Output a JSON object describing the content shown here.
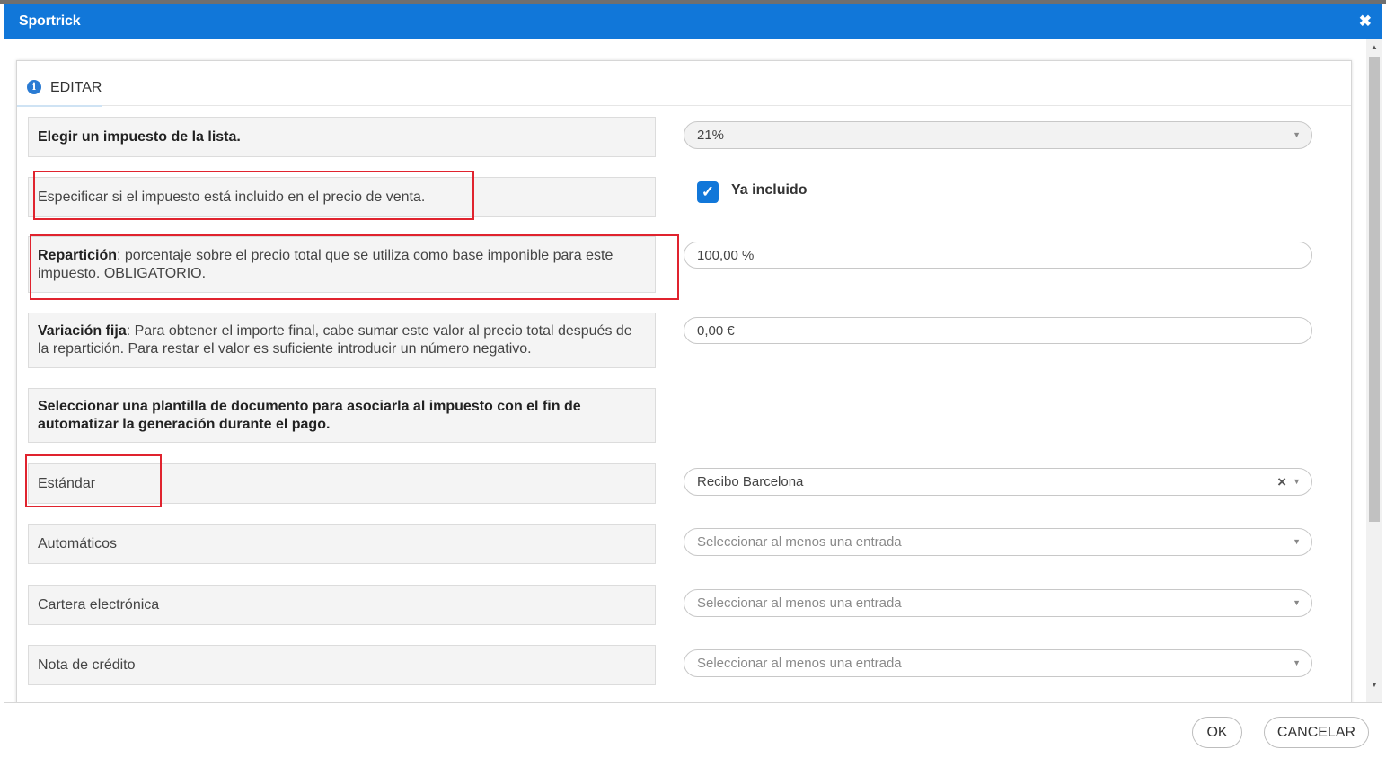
{
  "window": {
    "title": "Sportrick",
    "close_glyph": "✖"
  },
  "tab": {
    "icon": "info-icon",
    "label": "EDITAR"
  },
  "rows": {
    "tax": {
      "label": "Elegir un impuesto de la lista.",
      "value": "21%"
    },
    "included": {
      "label": "Especificar si el impuesto está incluido en el precio de venta.",
      "checkbox_label": "Ya incluido",
      "checked": true
    },
    "split": {
      "label_bold": "Repartición",
      "label_rest": ": porcentaje sobre el precio total que se utiliza como base imponible para este impuesto. OBLIGATORIO.",
      "value": "100,00 %"
    },
    "fixed": {
      "label_bold": "Variación fija",
      "label_rest": ": Para obtener el importe final, cabe sumar este valor al precio total después de la repartición. Para restar el valor es suficiente introducir un número negativo.",
      "value": "0,00 €"
    },
    "template_heading": "Seleccionar una plantilla de documento para asociarla al impuesto con el fin de automatizar la generación durante el pago.",
    "standard": {
      "label": "Estándar",
      "value": "Recibo Barcelona"
    },
    "automatic": {
      "label": "Automáticos",
      "placeholder": "Seleccionar al menos una entrada"
    },
    "wallet": {
      "label": "Cartera electrónica",
      "placeholder": "Seleccionar al menos una entrada"
    },
    "credit": {
      "label": "Nota de crédito",
      "placeholder": "Seleccionar al menos una entrada"
    }
  },
  "footer": {
    "ok": "OK",
    "cancel": "CANCELAR"
  },
  "colors": {
    "titlebar": "#1177d9",
    "highlight": "#e0232e"
  }
}
